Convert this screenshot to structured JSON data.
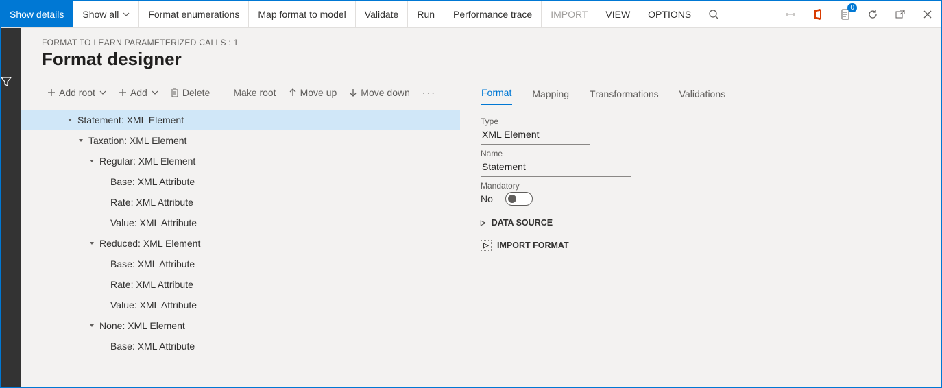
{
  "cmdbar": {
    "show_details": "Show details",
    "show_all": "Show all",
    "format_enumerations": "Format enumerations",
    "map_format": "Map format to model",
    "validate": "Validate",
    "run": "Run",
    "performance_trace": "Performance trace",
    "import": "IMPORT",
    "view": "VIEW",
    "options": "OPTIONS",
    "notification_count": "0"
  },
  "breadcrumb": "FORMAT TO LEARN PARAMETERIZED CALLS : 1",
  "title": "Format designer",
  "toolbar": {
    "add_root": "Add root",
    "add": "Add",
    "delete": "Delete",
    "make_root": "Make root",
    "move_up": "Move up",
    "move_down": "Move down"
  },
  "tree": [
    {
      "indent": 0,
      "expand": true,
      "label": "Statement: XML Element",
      "selected": true
    },
    {
      "indent": 1,
      "expand": true,
      "label": "Taxation: XML Element"
    },
    {
      "indent": 2,
      "expand": true,
      "label": "Regular: XML Element"
    },
    {
      "indent": 3,
      "expand": false,
      "leaf": true,
      "label": "Base: XML Attribute"
    },
    {
      "indent": 3,
      "expand": false,
      "leaf": true,
      "label": "Rate: XML Attribute"
    },
    {
      "indent": 3,
      "expand": false,
      "leaf": true,
      "label": "Value: XML Attribute"
    },
    {
      "indent": 2,
      "expand": true,
      "label": "Reduced: XML Element"
    },
    {
      "indent": 3,
      "expand": false,
      "leaf": true,
      "label": "Base: XML Attribute"
    },
    {
      "indent": 3,
      "expand": false,
      "leaf": true,
      "label": "Rate: XML Attribute"
    },
    {
      "indent": 3,
      "expand": false,
      "leaf": true,
      "label": "Value: XML Attribute"
    },
    {
      "indent": 2,
      "expand": true,
      "label": "None: XML Element"
    },
    {
      "indent": 3,
      "expand": false,
      "leaf": true,
      "label": "Base: XML Attribute"
    }
  ],
  "tabs": {
    "format": "Format",
    "mapping": "Mapping",
    "transformations": "Transformations",
    "validations": "Validations"
  },
  "form": {
    "type_label": "Type",
    "type_value": "XML Element",
    "name_label": "Name",
    "name_value": "Statement",
    "mandatory_label": "Mandatory",
    "mandatory_value": "No",
    "data_source": "DATA SOURCE",
    "import_format": "IMPORT FORMAT"
  }
}
